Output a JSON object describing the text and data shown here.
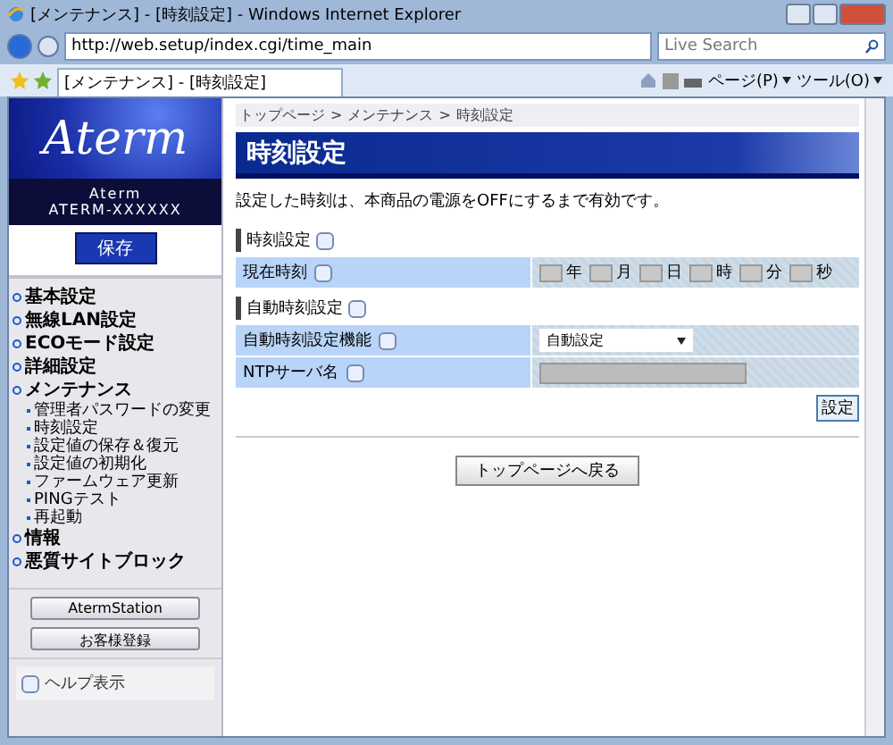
{
  "window": {
    "title": "[メンテナンス] - [時刻設定] - Windows Internet Explorer"
  },
  "address_bar": {
    "url": "http://web.setup/index.cgi/time_main"
  },
  "search": {
    "placeholder": "Live Search"
  },
  "tab": {
    "label": "[メンテナンス] - [時刻設定]",
    "selected": true
  },
  "toolbar": [
    "ページ(P)",
    "ツール(O)"
  ],
  "sidebar": {
    "logo": "Aterm",
    "device": [
      "Aterm",
      "ATERM-XXXXXX"
    ],
    "save_button": "保存",
    "nav": [
      {
        "label": "基本設定"
      },
      {
        "label": "無線LAN設定"
      },
      {
        "label": "ECOモード設定"
      },
      {
        "label": "詳細設定"
      },
      {
        "label": "メンテナンス",
        "children": [
          {
            "label": "管理者パスワードの変更"
          },
          {
            "label": "時刻設定"
          },
          {
            "label": "設定値の保存＆復元"
          },
          {
            "label": "設定値の初期化"
          },
          {
            "label": "ファームウェア更新"
          },
          {
            "label": "PINGテスト"
          },
          {
            "label": "再起動"
          }
        ]
      },
      {
        "label": "情報"
      },
      {
        "label": "悪質サイトブロック"
      }
    ],
    "buttons": [
      "AtermStation",
      "お客様登録"
    ],
    "help": "ヘルプ表示"
  },
  "main": {
    "breadcrumb": [
      "トップページ",
      "メンテナンス",
      "時刻設定"
    ],
    "breadcrumb_separator": ">",
    "title": "時刻設定",
    "note": "設定した時刻は、本商品の電源をOFFにするまで有効です。",
    "sections": [
      {
        "title": "時刻設定",
        "rows": [
          {
            "kind": "time",
            "label": "現在時刻",
            "fields": [
              {
                "unit": "年",
                "disabled": true
              },
              {
                "unit": "月",
                "disabled": true
              },
              {
                "unit": "日",
                "disabled": true
              },
              {
                "unit": "時",
                "disabled": true
              },
              {
                "unit": "分",
                "disabled": true
              },
              {
                "unit": "秒",
                "disabled": true
              }
            ]
          }
        ]
      },
      {
        "title": "自動時刻設定",
        "rows": [
          {
            "kind": "select",
            "label": "自動時刻設定機能",
            "value": "自動設定"
          },
          {
            "kind": "text",
            "label": "NTPサーバ名",
            "disabled": true
          }
        ]
      }
    ],
    "apply_button": "設定",
    "back_button": "トップページへ戻る"
  }
}
